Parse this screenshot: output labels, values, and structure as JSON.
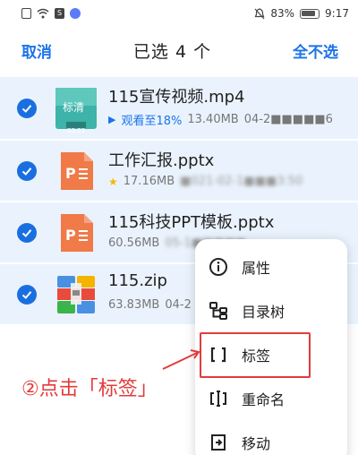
{
  "status_bar": {
    "battery": "83%",
    "time": "9:17"
  },
  "header": {
    "cancel_label": "取消",
    "title": "已选 4 个",
    "deselect_all_label": "全不选"
  },
  "files": [
    {
      "name": "115宣传视频.mp4",
      "thumb_label": "标清",
      "thumb_time": "03:29",
      "watch_progress": "观看至18%",
      "size": "13.40MB",
      "date": "04-2■■■■■6"
    },
    {
      "name": "工作汇报.pptx",
      "size": "17.16MB",
      "date": "■021-02-1■■■3:50"
    },
    {
      "name": "115科技PPT模板.pptx",
      "size": "60.56MB",
      "date": "05-1■■■■■"
    },
    {
      "name": "115.zip",
      "size": "63.83MB",
      "date": "04-2"
    }
  ],
  "menu": {
    "items": [
      {
        "label": "属性",
        "icon": "info-icon"
      },
      {
        "label": "目录树",
        "icon": "tree-icon"
      },
      {
        "label": "标签",
        "icon": "tag-bracket-icon"
      },
      {
        "label": "重命名",
        "icon": "rename-icon"
      },
      {
        "label": "移动",
        "icon": "move-icon"
      }
    ]
  },
  "annotation": {
    "text": "②点击「标签」"
  },
  "colors": {
    "accent": "#1c73e8",
    "selected_row": "#eaf3fd",
    "annotation_red": "#e23b3b"
  }
}
